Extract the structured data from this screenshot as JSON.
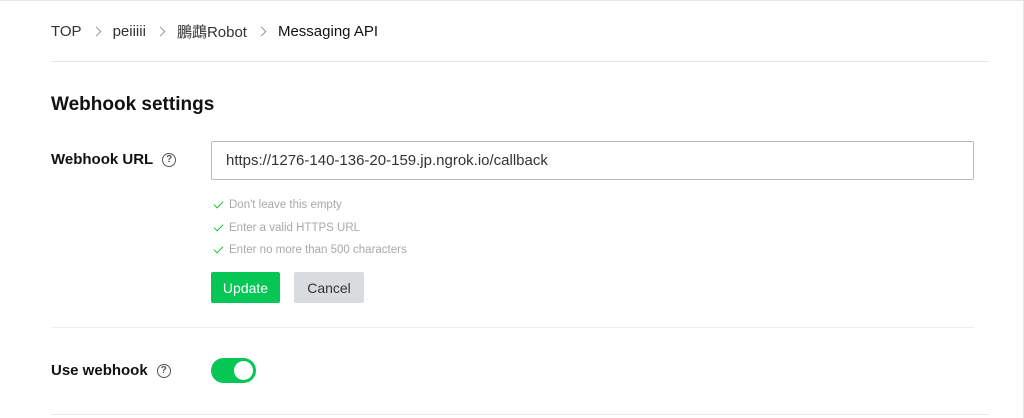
{
  "breadcrumb": {
    "items": [
      "TOP",
      "peiiiii",
      "鵬鵡Robot",
      "Messaging API"
    ]
  },
  "webhook_settings": {
    "title": "Webhook settings",
    "url_label": "Webhook URL",
    "url_value": "https://1276-140-136-20-159.jp.ngrok.io/callback",
    "validations": [
      "Don't leave this empty",
      "Enter a valid HTTPS URL",
      "Enter no more than 500 characters"
    ],
    "update_label": "Update",
    "cancel_label": "Cancel",
    "use_webhook_label": "Use webhook",
    "use_webhook_enabled": true,
    "help_glyph": "?"
  },
  "colors": {
    "accent_green": "#06c755",
    "check_green": "#22c13a",
    "cancel_gray": "#d9dcdf"
  },
  "icons": {
    "help": "help-icon",
    "check": "check-icon",
    "separator": "chevron-right-icon"
  }
}
